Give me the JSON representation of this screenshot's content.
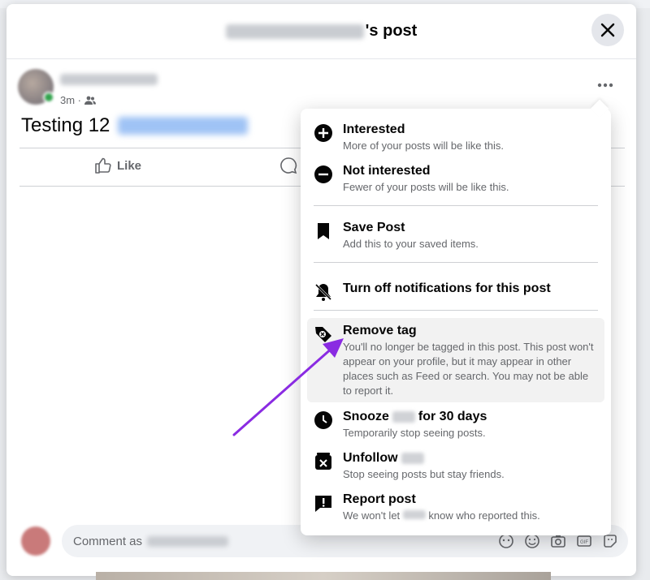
{
  "modal": {
    "title_suffix": "'s post",
    "close_label": "×"
  },
  "post": {
    "time": "3m ·",
    "text": "Testing 12"
  },
  "actions": {
    "like_label": "Like"
  },
  "comment": {
    "placeholder": "Comment as"
  },
  "menu": {
    "interested": {
      "title": "Interested",
      "desc": "More of your posts will be like this."
    },
    "not_interested": {
      "title": "Not interested",
      "desc": "Fewer of your posts will be like this."
    },
    "save": {
      "title": "Save Post",
      "desc": "Add this to your saved items."
    },
    "notifications": {
      "title": "Turn off notifications for this post"
    },
    "remove_tag": {
      "title": "Remove tag",
      "desc": "You'll no longer be tagged in this post. This post won't appear on your profile, but it may appear in other places such as Feed or search. You may not be able to report it."
    },
    "snooze": {
      "title_pre": "Snooze",
      "title_post": "for 30 days",
      "desc": "Temporarily stop seeing posts."
    },
    "unfollow": {
      "title": "Unfollow",
      "desc": "Stop seeing posts but stay friends."
    },
    "report": {
      "title": "Report post",
      "desc_pre": "We won't let",
      "desc_post": "know who reported this."
    }
  },
  "colors": {
    "accent_arrow": "#8a2be2",
    "highlight": "#f2f2f2"
  }
}
